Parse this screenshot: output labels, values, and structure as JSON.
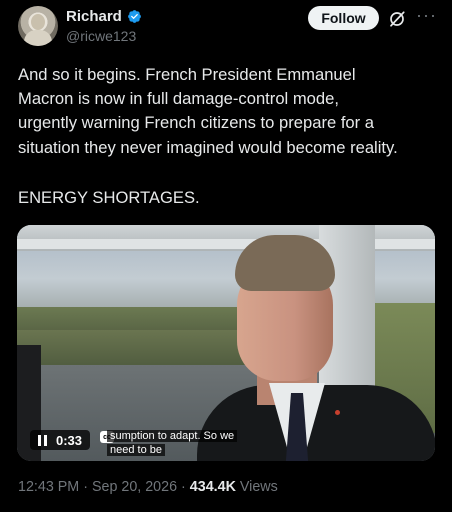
{
  "author": {
    "name": "Richard",
    "handle": "@ricwe123",
    "verified_color": "#1d9bf0"
  },
  "actions": {
    "follow_label": "Follow",
    "grok_icon": "grok-icon",
    "more_icon": "more-icon",
    "more_glyph": "···"
  },
  "tweet": {
    "text": "And so it begins. French President Emmanuel\nMacron is now in full damage-control mode,\nurgently warning French citizens to prepare for a\nsituation they never imagined would become reality.",
    "text2": "ENERGY SHORTAGES."
  },
  "video": {
    "time": "0:33",
    "cc_label": "cc",
    "caption_line1": "sumption to adapt.  So we",
    "caption_line2": "need to be"
  },
  "meta": {
    "time": "12:43 PM",
    "separator": "·",
    "date": "Sep 20, 2026",
    "views_count": "434.4K",
    "views_label": "Views"
  }
}
